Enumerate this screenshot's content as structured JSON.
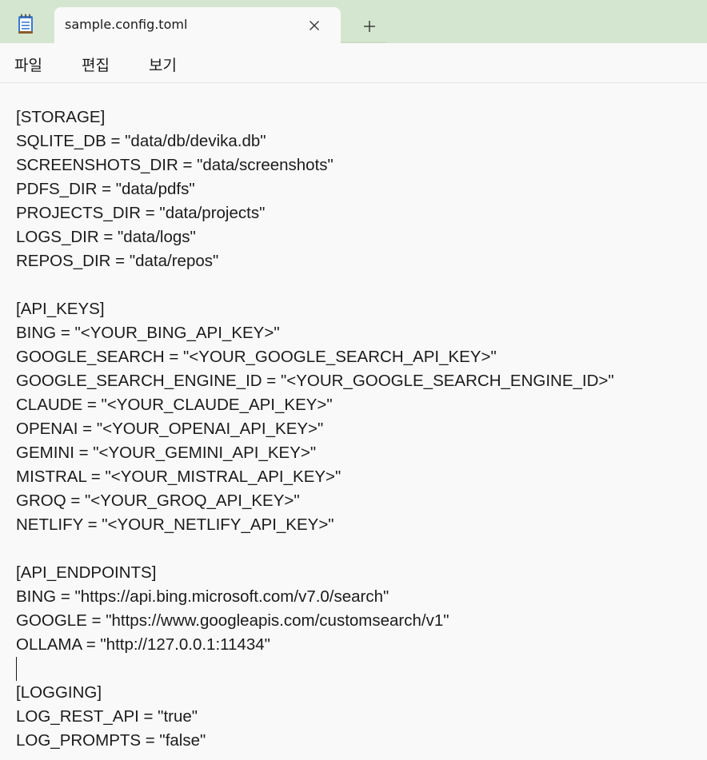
{
  "tab": {
    "title": "sample.config.toml",
    "app_icon": "notepad-icon",
    "close_icon": "close-icon",
    "new_tab_icon": "plus-icon"
  },
  "menu": {
    "file": "파일",
    "edit": "편집",
    "view": "보기"
  },
  "editor": {
    "lines": [
      "[STORAGE]",
      "SQLITE_DB = \"data/db/devika.db\"",
      "SCREENSHOTS_DIR = \"data/screenshots\"",
      "PDFS_DIR = \"data/pdfs\"",
      "PROJECTS_DIR = \"data/projects\"",
      "LOGS_DIR = \"data/logs\"",
      "REPOS_DIR = \"data/repos\"",
      "",
      "[API_KEYS]",
      "BING = \"<YOUR_BING_API_KEY>\"",
      "GOOGLE_SEARCH = \"<YOUR_GOOGLE_SEARCH_API_KEY>\"",
      "GOOGLE_SEARCH_ENGINE_ID = \"<YOUR_GOOGLE_SEARCH_ENGINE_ID>\"",
      "CLAUDE = \"<YOUR_CLAUDE_API_KEY>\"",
      "OPENAI = \"<YOUR_OPENAI_API_KEY>\"",
      "GEMINI = \"<YOUR_GEMINI_API_KEY>\"",
      "MISTRAL = \"<YOUR_MISTRAL_API_KEY>\"",
      "GROQ = \"<YOUR_GROQ_API_KEY>\"",
      "NETLIFY = \"<YOUR_NETLIFY_API_KEY>\"",
      "",
      "[API_ENDPOINTS]",
      "BING = \"https://api.bing.microsoft.com/v7.0/search\"",
      "GOOGLE = \"https://www.googleapis.com/customsearch/v1\"",
      "OLLAMA = \"http://127.0.0.1:11434\"",
      "",
      "[LOGGING]",
      "LOG_REST_API = \"true\"",
      "LOG_PROMPTS = \"false\""
    ]
  },
  "colors": {
    "titlebar_bg": "#d4e6cf",
    "editor_bg": "#f9f9f9",
    "text": "#1b1b1b"
  }
}
